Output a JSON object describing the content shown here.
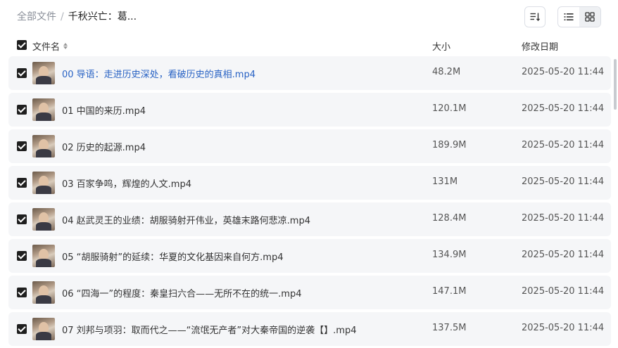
{
  "breadcrumb": {
    "root": "全部文件",
    "separator": "/",
    "current": "千秋兴亡：葛..."
  },
  "toolbar": {
    "sort_icon": "sort-list-icon",
    "list_view_icon": "list-view-icon",
    "grid_view_icon": "grid-view-icon",
    "active_view": "list"
  },
  "table": {
    "columns": {
      "name": "文件名",
      "size": "大小",
      "modified": "修改日期"
    },
    "rows": [
      {
        "name": "00 导语：走进历史深处，看破历史的真相.mp4",
        "size": "48.2M",
        "modified": "2025-05-20 11:44"
      },
      {
        "name": "01 中国的来历.mp4",
        "size": "120.1M",
        "modified": "2025-05-20 11:44"
      },
      {
        "name": "02 历史的起源.mp4",
        "size": "189.9M",
        "modified": "2025-05-20 11:44"
      },
      {
        "name": "03 百家争鸣，辉煌的人文.mp4",
        "size": "131M",
        "modified": "2025-05-20 11:44"
      },
      {
        "name": "04 赵武灵王的业绩：胡服骑射开伟业，英雄末路何悲凉.mp4",
        "size": "128.4M",
        "modified": "2025-05-20 11:44"
      },
      {
        "name": "05 “胡服骑射”的延续：华夏的文化基因来自何方.mp4",
        "size": "134.9M",
        "modified": "2025-05-20 11:44"
      },
      {
        "name": "06 “四海一”的程度：秦皇扫六合——无所不在的统一.mp4",
        "size": "147.1M",
        "modified": "2025-05-20 11:44"
      },
      {
        "name": "07 刘邦与项羽：取而代之——“流氓无产者”对大秦帝国的逆袭【】.mp4",
        "size": "137.5M",
        "modified": "2025-05-20 11:44"
      }
    ]
  },
  "colors": {
    "link": "#2862c4",
    "row_bg": "#f5f6f8",
    "checkbox": "#1f1f1f"
  }
}
